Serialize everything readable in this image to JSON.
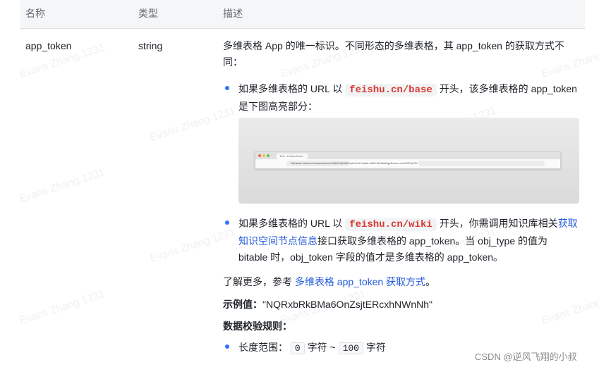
{
  "table": {
    "headers": {
      "name": "名称",
      "type": "类型",
      "desc": "描述"
    },
    "row": {
      "name": "app_token",
      "type": "string"
    }
  },
  "desc": {
    "intro": "多维表格 App 的唯一标识。不同形态的多维表格，其 app_token 的获取方式不同：",
    "bullet1": {
      "pre": "如果多维表格的 URL 以",
      "code": "feishu.cn/base",
      "post": "开头，该多维表格的 app_token 是下图高亮部分："
    },
    "browser": {
      "tab_title": "Test - Feishu Docs",
      "url": "fabriksen.feishu.cn/base/bascnxJ4ldD9qRaMcDpHnKoh?table=tblK7eE4lbaRgs&view=vewZXEZpTM"
    },
    "bullet2": {
      "pre": "如果多维表格的 URL 以",
      "code": "feishu.cn/wiki",
      "mid": "开头，你需调用知识库相关",
      "link": "获取知识空间节点信息",
      "post": "接口获取多维表格的 app_token。当 obj_type 的值为 bitable 时，obj_token 字段的值才是多维表格的 app_token。"
    },
    "learn_more": {
      "pre": "了解更多，参考",
      "link": "多维表格 app_token 获取方式",
      "post": "。"
    },
    "example": {
      "label": "示例值：",
      "value": "\"NQRxbRkBMa6OnZsjtERcxhNWnNh\""
    },
    "validation": {
      "title": "数据校验规则：",
      "range_label": "长度范围：",
      "min": "0",
      "unit1": "字符",
      "tilde": "~",
      "max": "100",
      "unit2": "字符"
    }
  },
  "watermark": "Evans Zhang 1231",
  "credit": "CSDN @逆风飞翔的小叔",
  "colors": {
    "accent": "#3370ff",
    "link": "#245bdb",
    "code": "#d83931"
  }
}
